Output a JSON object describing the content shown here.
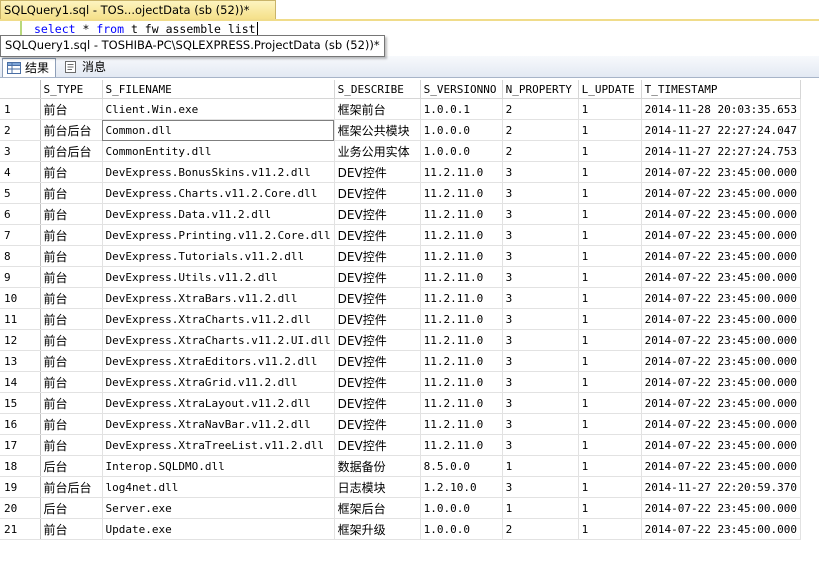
{
  "doc_tab": {
    "title": "SQLQuery1.sql - TOS...ojectData (sb (52))*"
  },
  "editor": {
    "keyword_select": "select",
    "star": " * ",
    "keyword_from": "from",
    "object": " t_fw_assemble_list"
  },
  "tooltip": {
    "text": "SQLQuery1.sql - TOSHIBA-PC\\SQLEXPRESS.ProjectData (sb (52))*"
  },
  "result_tabs": [
    {
      "label": "结果",
      "icon": "grid-icon",
      "active": true
    },
    {
      "label": "消息",
      "icon": "message-icon",
      "active": false
    }
  ],
  "grid": {
    "columns": [
      "S_TYPE",
      "S_FILENAME",
      "S_DESCRIBE",
      "S_VERSIONNO",
      "N_PROPERTY",
      "L_UPDATE",
      "T_TIMESTAMP"
    ],
    "rows": [
      [
        "1",
        "前台",
        "Client.Win.exe",
        "框架前台",
        "1.0.0.1",
        "2",
        "1",
        "2014-11-28 20:03:35.653"
      ],
      [
        "2",
        "前台后台",
        "Common.dll",
        "框架公共模块",
        "1.0.0.0",
        "2",
        "1",
        "2014-11-27 22:27:24.047"
      ],
      [
        "3",
        "前台后台",
        "CommonEntity.dll",
        "业务公用实体",
        "1.0.0.0",
        "2",
        "1",
        "2014-11-27 22:27:24.753"
      ],
      [
        "4",
        "前台",
        "DevExpress.BonusSkins.v11.2.dll",
        "DEV控件",
        "11.2.11.0",
        "3",
        "1",
        "2014-07-22 23:45:00.000"
      ],
      [
        "5",
        "前台",
        "DevExpress.Charts.v11.2.Core.dll",
        "DEV控件",
        "11.2.11.0",
        "3",
        "1",
        "2014-07-22 23:45:00.000"
      ],
      [
        "6",
        "前台",
        "DevExpress.Data.v11.2.dll",
        "DEV控件",
        "11.2.11.0",
        "3",
        "1",
        "2014-07-22 23:45:00.000"
      ],
      [
        "7",
        "前台",
        "DevExpress.Printing.v11.2.Core.dll",
        "DEV控件",
        "11.2.11.0",
        "3",
        "1",
        "2014-07-22 23:45:00.000"
      ],
      [
        "8",
        "前台",
        "DevExpress.Tutorials.v11.2.dll",
        "DEV控件",
        "11.2.11.0",
        "3",
        "1",
        "2014-07-22 23:45:00.000"
      ],
      [
        "9",
        "前台",
        "DevExpress.Utils.v11.2.dll",
        "DEV控件",
        "11.2.11.0",
        "3",
        "1",
        "2014-07-22 23:45:00.000"
      ],
      [
        "10",
        "前台",
        "DevExpress.XtraBars.v11.2.dll",
        "DEV控件",
        "11.2.11.0",
        "3",
        "1",
        "2014-07-22 23:45:00.000"
      ],
      [
        "11",
        "前台",
        "DevExpress.XtraCharts.v11.2.dll",
        "DEV控件",
        "11.2.11.0",
        "3",
        "1",
        "2014-07-22 23:45:00.000"
      ],
      [
        "12",
        "前台",
        "DevExpress.XtraCharts.v11.2.UI.dll",
        "DEV控件",
        "11.2.11.0",
        "3",
        "1",
        "2014-07-22 23:45:00.000"
      ],
      [
        "13",
        "前台",
        "DevExpress.XtraEditors.v11.2.dll",
        "DEV控件",
        "11.2.11.0",
        "3",
        "1",
        "2014-07-22 23:45:00.000"
      ],
      [
        "14",
        "前台",
        "DevExpress.XtraGrid.v11.2.dll",
        "DEV控件",
        "11.2.11.0",
        "3",
        "1",
        "2014-07-22 23:45:00.000"
      ],
      [
        "15",
        "前台",
        "DevExpress.XtraLayout.v11.2.dll",
        "DEV控件",
        "11.2.11.0",
        "3",
        "1",
        "2014-07-22 23:45:00.000"
      ],
      [
        "16",
        "前台",
        "DevExpress.XtraNavBar.v11.2.dll",
        "DEV控件",
        "11.2.11.0",
        "3",
        "1",
        "2014-07-22 23:45:00.000"
      ],
      [
        "17",
        "前台",
        "DevExpress.XtraTreeList.v11.2.dll",
        "DEV控件",
        "11.2.11.0",
        "3",
        "1",
        "2014-07-22 23:45:00.000"
      ],
      [
        "18",
        "后台",
        "Interop.SQLDMO.dll",
        "数据备份",
        "8.5.0.0",
        "1",
        "1",
        "2014-07-22 23:45:00.000"
      ],
      [
        "19",
        "前台后台",
        "log4net.dll",
        "日志模块",
        "1.2.10.0",
        "3",
        "1",
        "2014-11-27 22:20:59.370"
      ],
      [
        "20",
        "后台",
        "Server.exe",
        "框架后台",
        "1.0.0.0",
        "1",
        "1",
        "2014-07-22 23:45:00.000"
      ],
      [
        "21",
        "前台",
        "Update.exe",
        "框架升级",
        "1.0.0.0",
        "2",
        "1",
        "2014-07-22 23:45:00.000"
      ]
    ],
    "selected_cell": {
      "row": 2,
      "column": "S_FILENAME"
    }
  }
}
